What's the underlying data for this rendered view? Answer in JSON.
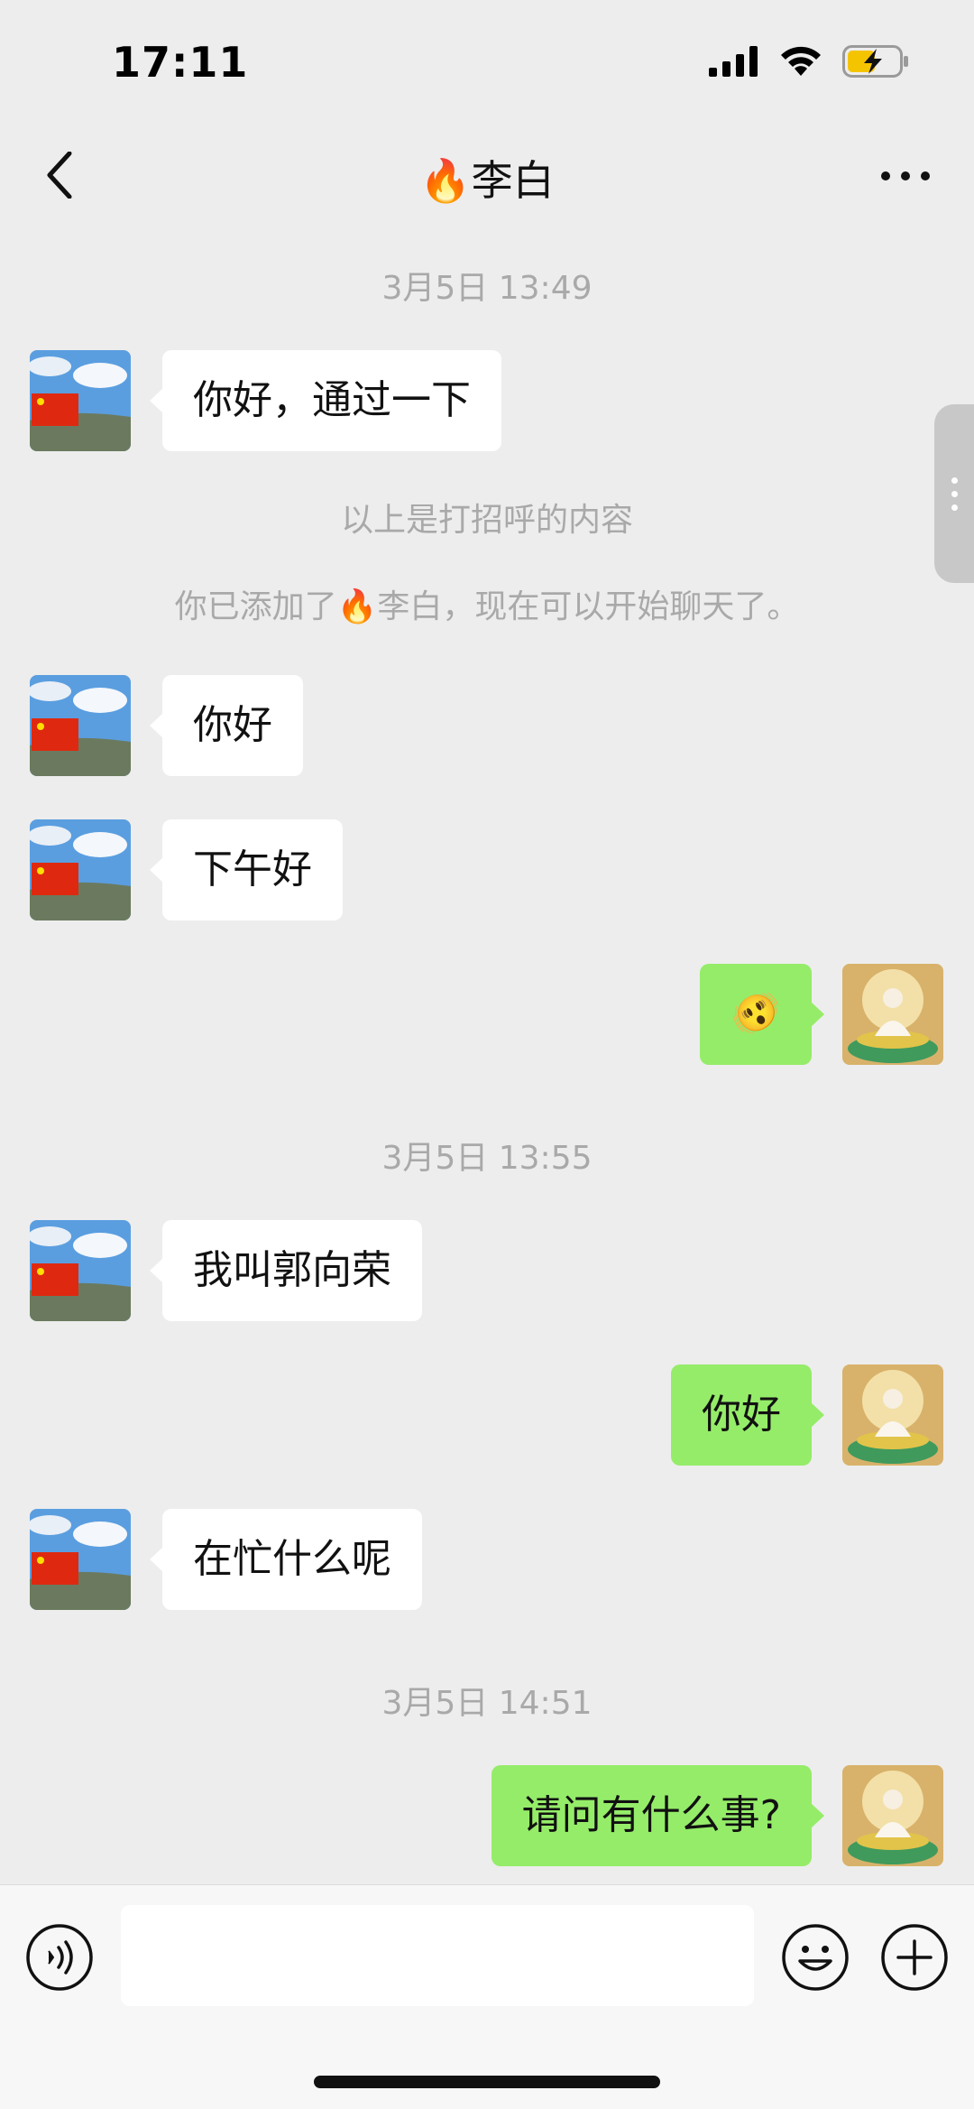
{
  "status_bar": {
    "time": "17:11"
  },
  "header": {
    "title": "🔥李白"
  },
  "messages": {
    "ts1": "3月5日 13:49",
    "m1": "你好，通过一下",
    "sys1": "以上是打招呼的内容",
    "sys2": "你已添加了🔥李白，现在可以开始聊天了。",
    "m2": "你好",
    "m3": "下午好",
    "m4": "🫨",
    "ts2": "3月5日 13:55",
    "m5": "我叫郭向荣",
    "m6": "你好",
    "m7": "在忙什么呢",
    "ts3": "3月5日 14:51",
    "m8": "请问有什么事?"
  },
  "colors": {
    "background": "#ededed",
    "incoming_bubble": "#ffffff",
    "outgoing_bubble": "#95ec69",
    "meta_text": "#a9a9a9",
    "battery_fill": "#f5c400"
  },
  "icons": {
    "back": "chevron-left-icon",
    "more": "more-horizontal-icon",
    "voice": "voice-icon",
    "emoji": "smiley-icon",
    "plus": "plus-circle-icon"
  }
}
